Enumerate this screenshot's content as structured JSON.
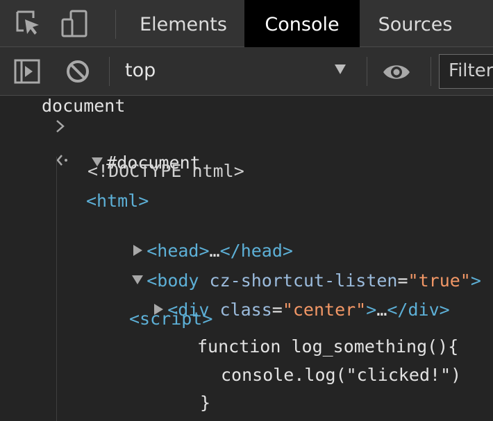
{
  "tabs": {
    "elements": "Elements",
    "console": "Console",
    "sources": "Sources"
  },
  "toolbar": {
    "context": "top",
    "filter_placeholder": "Filter"
  },
  "console": {
    "input_text": "document",
    "result_node": "#document",
    "doctype": "<!DOCTYPE html>",
    "html_open": "<html>",
    "head_open": "<head>",
    "head_ellipsis": "…",
    "head_close": "</head>",
    "body_open": "<body",
    "body_attr_name": "cz-shortcut-listen",
    "body_attr_eq": "=",
    "body_attr_value": "\"true\"",
    "body_close_bracket": ">",
    "div_open": "<div",
    "div_attr_name": "class",
    "div_attr_eq": "=",
    "div_attr_value": "\"center\"",
    "div_bracket": ">",
    "div_ellipsis": "…",
    "div_close": "</div>",
    "script_open": "<script>",
    "code_line_1": "function log_something(){",
    "code_line_2": "console.log(\"clicked!\")",
    "code_line_3": "}"
  },
  "colors": {
    "tag": "#5db0d7",
    "attribute": "#9bbbdc",
    "attribute_value": "#f29766",
    "active_tab_bg": "#000000"
  },
  "icons": {
    "inspect": "inspect-element-icon",
    "device": "device-toolbar-icon",
    "sidebar": "show-console-sidebar-icon",
    "clear": "clear-console-icon",
    "eye": "live-expression-icon",
    "prompt": "chevron-right-icon",
    "result": "result-arrow-icon"
  }
}
